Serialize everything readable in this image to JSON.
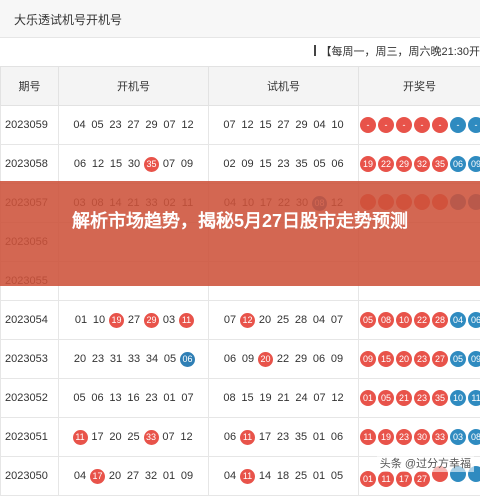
{
  "page_title": "大乐透试机号开机号",
  "schedule": "【每周一，周三，周六晚21:30开",
  "columns": [
    "期号",
    "开机号",
    "试机号",
    "开奖号"
  ],
  "rows": [
    {
      "issue": "2023059",
      "open": [
        {
          "n": "04"
        },
        {
          "n": "05"
        },
        {
          "n": "23"
        },
        {
          "n": "27"
        },
        {
          "n": "29"
        },
        {
          "n": "07"
        },
        {
          "n": "12"
        }
      ],
      "trial": [
        {
          "n": "07"
        },
        {
          "n": "12"
        },
        {
          "n": "15"
        },
        {
          "n": "27"
        },
        {
          "n": "29"
        },
        {
          "n": "04"
        },
        {
          "n": "10"
        }
      ],
      "draw": [
        {
          "n": "-",
          "c": "red"
        },
        {
          "n": "-",
          "c": "red"
        },
        {
          "n": "-",
          "c": "red"
        },
        {
          "n": "-",
          "c": "red"
        },
        {
          "n": "-",
          "c": "red"
        },
        {
          "n": "-",
          "c": "blue"
        },
        {
          "n": "-",
          "c": "blue"
        }
      ]
    },
    {
      "issue": "2023058",
      "open": [
        {
          "n": "06"
        },
        {
          "n": "12"
        },
        {
          "n": "15"
        },
        {
          "n": "30"
        },
        {
          "n": "35",
          "c": "red"
        },
        {
          "n": "07"
        },
        {
          "n": "09"
        }
      ],
      "trial": [
        {
          "n": "02"
        },
        {
          "n": "09"
        },
        {
          "n": "15"
        },
        {
          "n": "23"
        },
        {
          "n": "35"
        },
        {
          "n": "05"
        },
        {
          "n": "06"
        }
      ],
      "draw": [
        {
          "n": "19",
          "c": "red"
        },
        {
          "n": "22",
          "c": "red"
        },
        {
          "n": "29",
          "c": "red"
        },
        {
          "n": "32",
          "c": "red"
        },
        {
          "n": "35",
          "c": "red"
        },
        {
          "n": "06",
          "c": "blue"
        },
        {
          "n": "09",
          "c": "blue"
        }
      ]
    },
    {
      "issue": "2023057",
      "open": [
        {
          "n": "03"
        },
        {
          "n": "08"
        },
        {
          "n": "14"
        },
        {
          "n": "21"
        },
        {
          "n": "33"
        },
        {
          "n": "02"
        },
        {
          "n": "11"
        }
      ],
      "trial": [
        {
          "n": "04"
        },
        {
          "n": "10"
        },
        {
          "n": "17"
        },
        {
          "n": "22"
        },
        {
          "n": "30"
        },
        {
          "n": "08",
          "c": "blue"
        },
        {
          "n": "12"
        }
      ],
      "draw": [
        {
          "n": "",
          "c": "red"
        },
        {
          "n": "",
          "c": "red"
        },
        {
          "n": "",
          "c": "red"
        },
        {
          "n": "",
          "c": "red"
        },
        {
          "n": "",
          "c": "red"
        },
        {
          "n": "",
          "c": "blue"
        },
        {
          "n": "",
          "c": "blue"
        }
      ]
    },
    {
      "issue": "2023056",
      "open": [],
      "trial": [],
      "draw": []
    },
    {
      "issue": "2023055",
      "open": [
        {
          "n": ""
        }
      ],
      "trial": [],
      "draw": []
    },
    {
      "issue": "2023054",
      "open": [
        {
          "n": "01"
        },
        {
          "n": "10"
        },
        {
          "n": "19",
          "c": "red"
        },
        {
          "n": "27"
        },
        {
          "n": "29",
          "c": "red"
        },
        {
          "n": "03"
        },
        {
          "n": "11",
          "c": "red"
        }
      ],
      "trial": [
        {
          "n": "07"
        },
        {
          "n": "12",
          "c": "red"
        },
        {
          "n": "20"
        },
        {
          "n": "25"
        },
        {
          "n": "28"
        },
        {
          "n": "04"
        },
        {
          "n": "07"
        }
      ],
      "draw": [
        {
          "n": "05",
          "c": "red"
        },
        {
          "n": "08",
          "c": "red"
        },
        {
          "n": "10",
          "c": "red"
        },
        {
          "n": "22",
          "c": "red"
        },
        {
          "n": "28",
          "c": "red"
        },
        {
          "n": "04",
          "c": "blue"
        },
        {
          "n": "06",
          "c": "blue"
        }
      ]
    },
    {
      "issue": "2023053",
      "open": [
        {
          "n": "20"
        },
        {
          "n": "23"
        },
        {
          "n": "31"
        },
        {
          "n": "33"
        },
        {
          "n": "34"
        },
        {
          "n": "05"
        },
        {
          "n": "06",
          "c": "blue"
        }
      ],
      "trial": [
        {
          "n": "06"
        },
        {
          "n": "09"
        },
        {
          "n": "20",
          "c": "red"
        },
        {
          "n": "22"
        },
        {
          "n": "29"
        },
        {
          "n": "06"
        },
        {
          "n": "09"
        }
      ],
      "draw": [
        {
          "n": "09",
          "c": "red"
        },
        {
          "n": "15",
          "c": "red"
        },
        {
          "n": "20",
          "c": "red"
        },
        {
          "n": "23",
          "c": "red"
        },
        {
          "n": "27",
          "c": "red"
        },
        {
          "n": "05",
          "c": "blue"
        },
        {
          "n": "09",
          "c": "blue"
        }
      ]
    },
    {
      "issue": "2023052",
      "open": [
        {
          "n": "05"
        },
        {
          "n": "06"
        },
        {
          "n": "13"
        },
        {
          "n": "16"
        },
        {
          "n": "23"
        },
        {
          "n": "01"
        },
        {
          "n": "07"
        }
      ],
      "trial": [
        {
          "n": "08"
        },
        {
          "n": "15"
        },
        {
          "n": "19"
        },
        {
          "n": "21"
        },
        {
          "n": "24"
        },
        {
          "n": "07"
        },
        {
          "n": "12"
        }
      ],
      "draw": [
        {
          "n": "01",
          "c": "red"
        },
        {
          "n": "05",
          "c": "red"
        },
        {
          "n": "21",
          "c": "red"
        },
        {
          "n": "23",
          "c": "red"
        },
        {
          "n": "35",
          "c": "red"
        },
        {
          "n": "10",
          "c": "blue"
        },
        {
          "n": "11",
          "c": "blue"
        }
      ]
    },
    {
      "issue": "2023051",
      "open": [
        {
          "n": "11",
          "c": "red"
        },
        {
          "n": "17"
        },
        {
          "n": "20"
        },
        {
          "n": "25"
        },
        {
          "n": "33",
          "c": "red"
        },
        {
          "n": "07"
        },
        {
          "n": "12"
        }
      ],
      "trial": [
        {
          "n": "06"
        },
        {
          "n": "11",
          "c": "red"
        },
        {
          "n": "17"
        },
        {
          "n": "23"
        },
        {
          "n": "35"
        },
        {
          "n": "01"
        },
        {
          "n": "06"
        }
      ],
      "draw": [
        {
          "n": "11",
          "c": "red"
        },
        {
          "n": "19",
          "c": "red"
        },
        {
          "n": "23",
          "c": "red"
        },
        {
          "n": "30",
          "c": "red"
        },
        {
          "n": "33",
          "c": "red"
        },
        {
          "n": "03",
          "c": "blue"
        },
        {
          "n": "08",
          "c": "blue"
        }
      ]
    },
    {
      "issue": "2023050",
      "open": [
        {
          "n": "04"
        },
        {
          "n": "17",
          "c": "red"
        },
        {
          "n": "20"
        },
        {
          "n": "27"
        },
        {
          "n": "32"
        },
        {
          "n": "01"
        },
        {
          "n": "09"
        }
      ],
      "trial": [
        {
          "n": "04"
        },
        {
          "n": "11",
          "c": "red"
        },
        {
          "n": "14"
        },
        {
          "n": "18"
        },
        {
          "n": "25"
        },
        {
          "n": "01"
        },
        {
          "n": "05"
        }
      ],
      "draw": [
        {
          "n": "01",
          "c": "red"
        },
        {
          "n": "11",
          "c": "red"
        },
        {
          "n": "17",
          "c": "red"
        },
        {
          "n": "27",
          "c": "red"
        },
        {
          "n": "",
          "c": "red"
        },
        {
          "n": "",
          "c": "blue"
        },
        {
          "n": "",
          "c": "blue"
        }
      ]
    }
  ],
  "overlay_headline": "解析市场趋势，揭秘5月27日股市走势预测",
  "watermark": "头条 @过分方幸福",
  "colors": {
    "red_ball": "#e8534a",
    "blue_ball": "#2f8bc0",
    "overlay": "#cd523a"
  }
}
